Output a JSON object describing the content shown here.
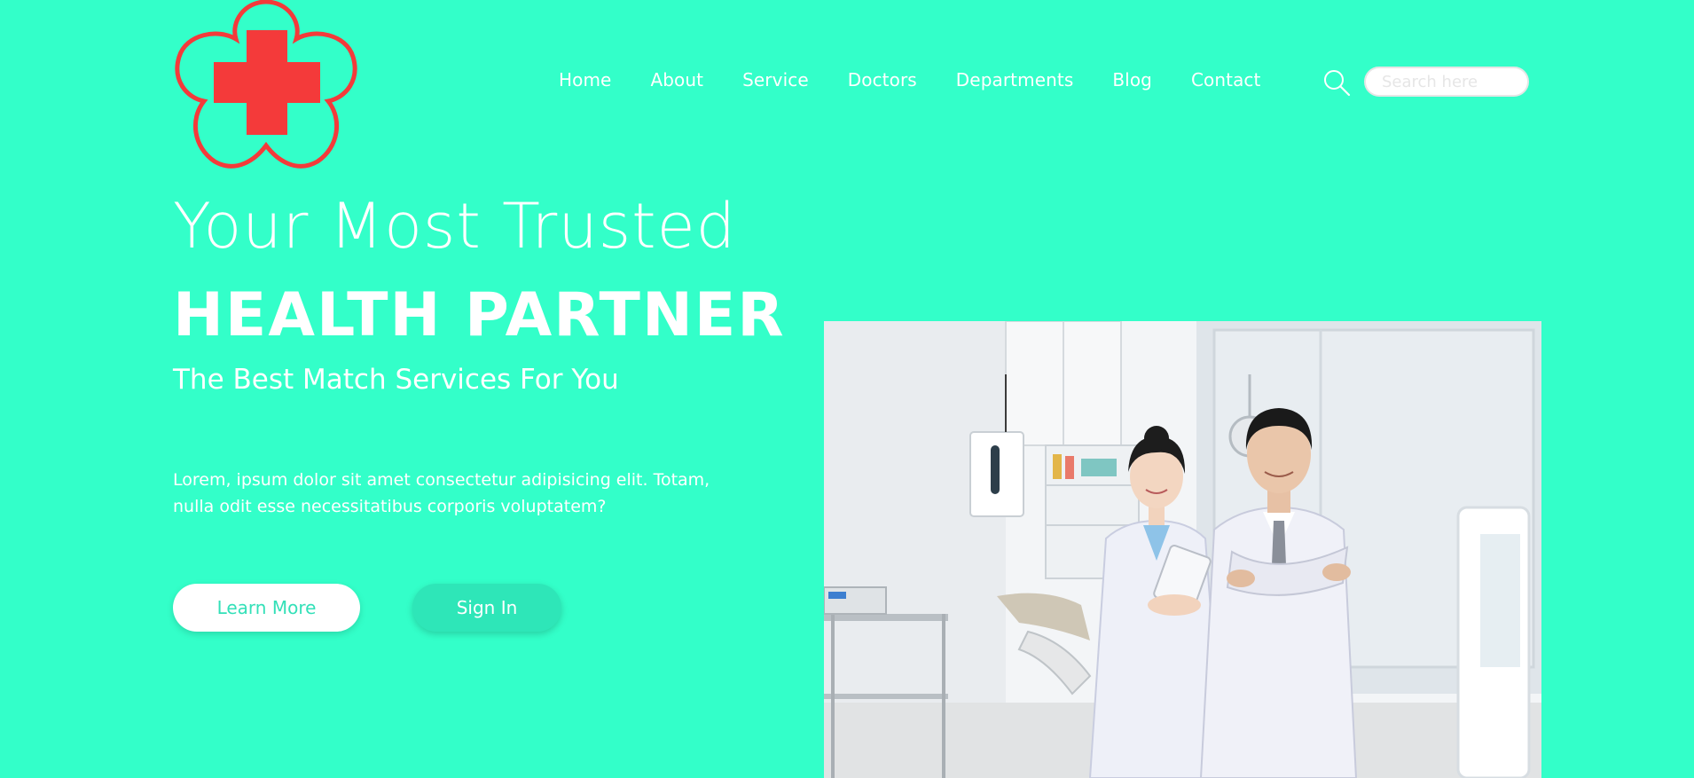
{
  "brand": {
    "logo_icon": "medical-cross-flower-icon",
    "logo_colors": {
      "outline": "#f43a3a",
      "cross": "#f43a3a"
    }
  },
  "nav": {
    "items": [
      "Home",
      "About",
      "Service",
      "Doctors",
      "Departments",
      "Blog",
      "Contact"
    ]
  },
  "search": {
    "icon": "search-icon",
    "placeholder": "Search here",
    "value": ""
  },
  "hero": {
    "title_line1": "Your Most Trusted",
    "title_line2": "HEALTH PARTNER",
    "subtitle": "The Best Match Services For You",
    "description": "Lorem, ipsum dolor sit amet consectetur adipisicing elit. Totam, nulla odit esse necessitatibus corporis voluptatem?",
    "primary_button": "Learn More",
    "secondary_button": "Sign In",
    "image": "two-doctors-in-clinic-photo"
  },
  "colors": {
    "background": "#33ffc9",
    "text": "#ffffff",
    "accent": "#33e0b8"
  }
}
